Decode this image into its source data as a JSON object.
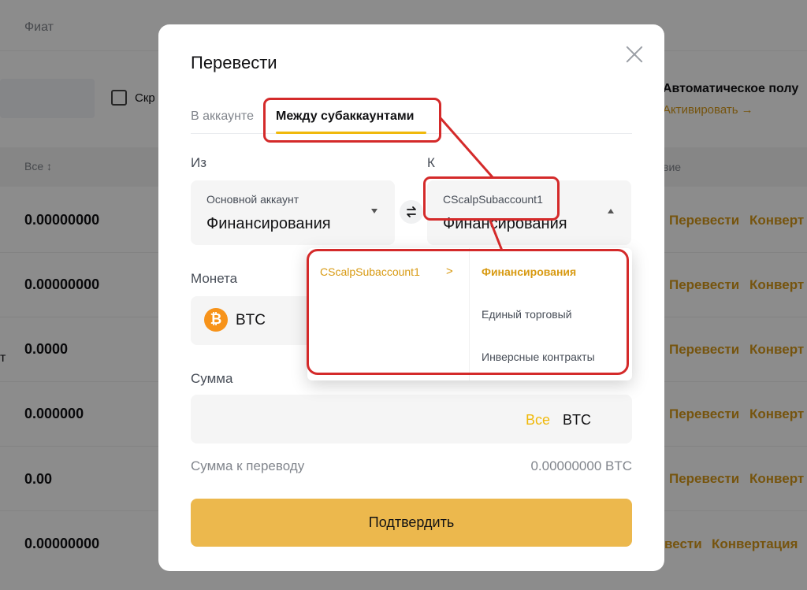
{
  "background": {
    "tab_label": "Фиат",
    "hide_checkbox_label": "Скр",
    "auto_title": "Автоматическое полу",
    "auto_link": "Активировать →",
    "col_all": "Все ↕",
    "col_actions": "вие",
    "left_cut_text": "т",
    "rows": [
      {
        "balance": "0.00000000",
        "transfer": "Перевести",
        "convert": "Конверт"
      },
      {
        "balance": "0.00000000",
        "transfer": "Перевести",
        "convert": "Конверт"
      },
      {
        "balance": "0.0000",
        "transfer": "Перевести",
        "convert": "Конверт"
      },
      {
        "balance": "0.000000",
        "transfer": "Перевести",
        "convert": "Конверт"
      },
      {
        "balance": "0.00",
        "transfer": "Перевести",
        "convert": "Конверт"
      },
      {
        "balance": "0.00000000",
        "transfer": "вести",
        "convert": "Конвертация"
      }
    ]
  },
  "modal": {
    "title": "Перевести",
    "tabs": [
      {
        "label": "В аккаунте",
        "active": false
      },
      {
        "label": "Между субаккаунтами",
        "active": true
      }
    ],
    "from": {
      "label": "Из",
      "account_type": "Основной аккаунт",
      "wallet": "Финансирования"
    },
    "to": {
      "label": "К",
      "account_type": "CScalpSubaccount1",
      "wallet": "Финансирования"
    },
    "coin": {
      "label": "Монета",
      "symbol": "BTC",
      "icon": "bitcoin-icon"
    },
    "amount": {
      "label": "Сумма",
      "all_label": "Все",
      "unit": "BTC"
    },
    "receive": {
      "label": "Сумма к переводу",
      "value": "0.00000000 BTC"
    },
    "confirm_label": "Подтвердить"
  },
  "dropdown": {
    "account": "CScalpSubaccount1",
    "chevron": ">",
    "options": [
      {
        "label": "Финансирования",
        "selected": true
      },
      {
        "label": "Единый торговый",
        "selected": false
      },
      {
        "label": "Инверсные контракты",
        "selected": false
      }
    ]
  },
  "colors": {
    "accent": "#f0b90b",
    "confirm_button": "#ecb84d",
    "annotation": "#d42a2a",
    "link": "#d79a1a"
  }
}
